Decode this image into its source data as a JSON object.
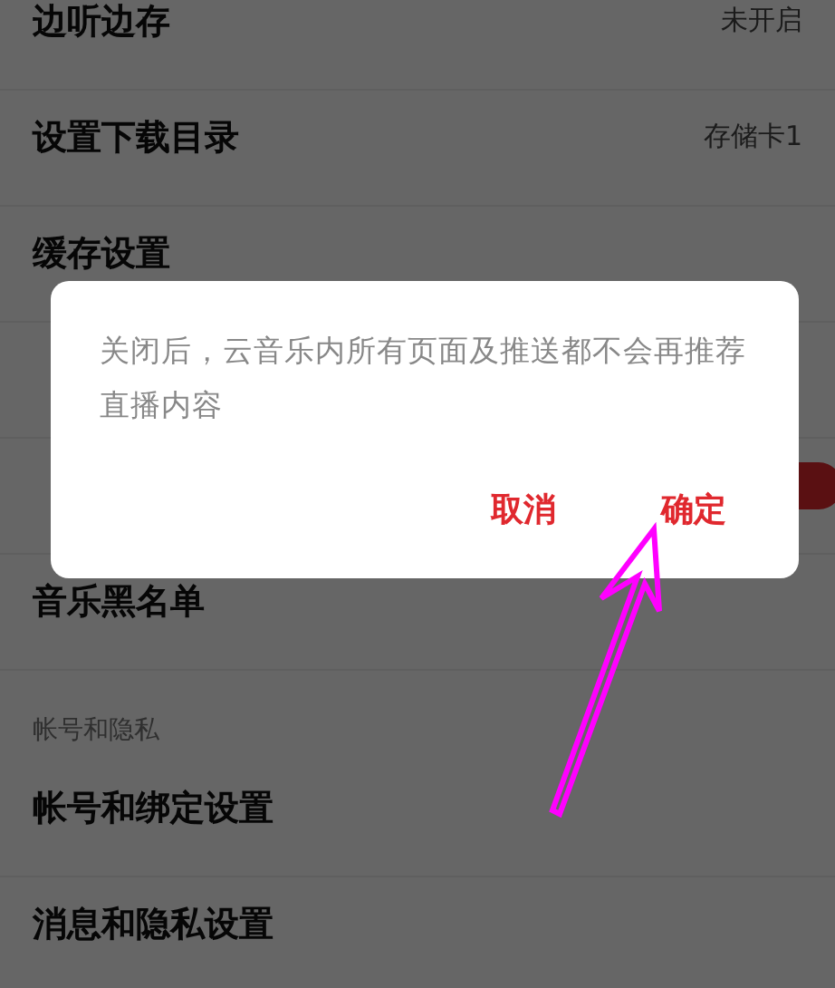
{
  "settings": [
    {
      "kind": "value",
      "label": "边听边存",
      "value": "未开启"
    },
    {
      "kind": "value",
      "label": "设置下载目录",
      "value": "存储卡1"
    },
    {
      "kind": "plain",
      "label": "缓存设置"
    },
    {
      "kind": "plain"
    },
    {
      "kind": "toggle",
      "on": true
    },
    {
      "kind": "plain",
      "label": "音乐黑名单"
    },
    {
      "kind": "section",
      "label": "帐号和隐私"
    },
    {
      "kind": "plain",
      "label": "帐号和绑定设置"
    },
    {
      "kind": "plain",
      "label": "消息和隐私设置"
    }
  ],
  "dialog": {
    "message": "关闭后，云音乐内所有页面及推送都不会再推荐直播内容",
    "buttons": [
      {
        "label": "取消"
      },
      {
        "label": "确定"
      }
    ]
  }
}
